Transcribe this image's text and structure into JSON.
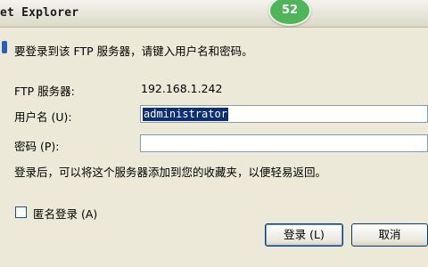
{
  "window": {
    "title": "et Explorer",
    "badge": "52"
  },
  "dialog": {
    "prompt": "要登录到该 FTP 服务器，请键入用户名和密码。",
    "server_label": "FTP 服务器:",
    "server_value": "192.168.1.242",
    "username_label": "用户名 (U):",
    "username_value": "administrator",
    "password_label": "密码 (P):",
    "password_value": "",
    "note": "登录后，可以将这个服务器添加到您的收藏夹，以便轻易返回。",
    "anonymous_label": "匿名登录 (A)",
    "login_button": "登录 (L)",
    "cancel_button": "取消"
  },
  "colors": {
    "selection": "#0b2d7a",
    "badge": "#4fb45a"
  }
}
